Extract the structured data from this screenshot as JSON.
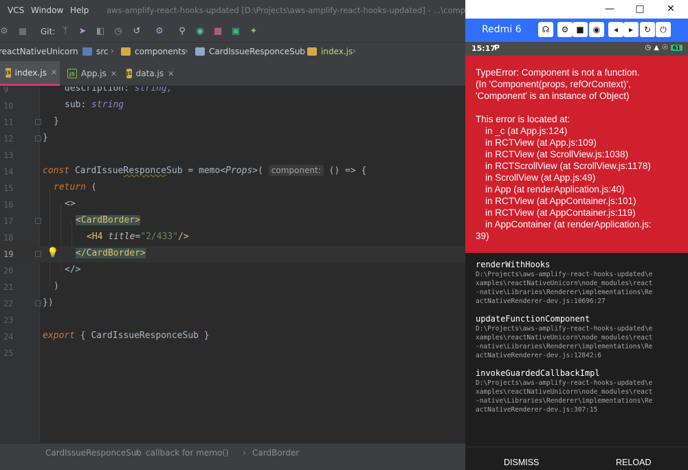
{
  "ide": {
    "menu": [
      "VCS",
      "Window",
      "Help"
    ],
    "window_title": "aws-amplify-react-hooks-updated [D:\\Projects\\aws-amplify-react-hooks-updated] - ...\\components",
    "git_label": "Git:",
    "breadcrumbs": [
      "reactNativeUnicorn",
      "src",
      "components",
      "CardIssueResponceSub",
      "index.js"
    ],
    "tabs": [
      {
        "label": "index.js",
        "icon": "js-file-icon",
        "active": true
      },
      {
        "label": "App.js",
        "icon": "node-file-icon",
        "active": false
      },
      {
        "label": "data.js",
        "icon": "js-file-icon",
        "active": false
      }
    ],
    "code_lines": [
      {
        "num": "9",
        "text": "description: string,"
      },
      {
        "num": "10",
        "text": "sub: string"
      },
      {
        "num": "11",
        "text": "}"
      },
      {
        "num": "12",
        "text": "}"
      },
      {
        "num": "13",
        "text": ""
      },
      {
        "num": "14",
        "text": "const CardIssueResponceSub = memo<Props>( component: () => {"
      },
      {
        "num": "15",
        "text": "return ("
      },
      {
        "num": "16",
        "text": "<>"
      },
      {
        "num": "17",
        "text": "<CardBorder>"
      },
      {
        "num": "18",
        "text": "<H4 title=\"2/433\"/>"
      },
      {
        "num": "19",
        "text": "</CardBorder>"
      },
      {
        "num": "20",
        "text": "</>"
      },
      {
        "num": "21",
        "text": ")"
      },
      {
        "num": "22",
        "text": "})"
      },
      {
        "num": "23",
        "text": ""
      },
      {
        "num": "24",
        "text": "export { CardIssueResponceSub }"
      },
      {
        "num": "25",
        "text": ""
      }
    ],
    "code_tokens": {
      "l9_prop": "description:",
      "l9_type": "string,",
      "l10_prop": "sub:",
      "l10_type": "string",
      "l14_const": "const",
      "l14_name_a": "CardIssue",
      "l14_name_b": "Responce",
      "l14_name_c": "Sub",
      "l14_eq": "=",
      "l14_memo": "memo",
      "l14_lt": "<",
      "l14_props": "Props",
      "l14_gt": ">(",
      "l14_hint": "component:",
      "l14_arrow": "() => {",
      "l15_return": "return",
      "l15_paren": "(",
      "l16": "<>",
      "l17_lt": "<",
      "l17_tag": "CardBorder",
      "l17_gt": ">",
      "l18_lt": "<",
      "l18_tag": "H4",
      "l18_attr": "title",
      "l18_eq": "=",
      "l18_str": "\"2/433\"",
      "l18_end": "/>",
      "l19_lt": "</",
      "l19_tag": "CardBorder",
      "l19_gt": ">",
      "l20": "</>",
      "l21": ")",
      "l22": "})",
      "l11": "}",
      "l12": "}",
      "l24_export": "export",
      "l24_rest": "{ CardIssueResponceSub }"
    },
    "statusbar": [
      "CardIssueResponceSub",
      "callback for memo()",
      "CardBorder"
    ],
    "colors": {
      "tab_accent": "#d5366e",
      "keyword": "#cc7832",
      "function": "#ffc66d",
      "string": "#6a8759"
    }
  },
  "emulator": {
    "device_name": "Redmi 6",
    "window_controls": [
      "minimize-icon",
      "maximize-icon",
      "close-icon"
    ],
    "device_buttons": [
      "headphones-icon",
      "settings-icon",
      "video-icon",
      "camera-icon",
      "volume-down-icon",
      "volume-up-icon",
      "rotate-icon",
      "power-icon"
    ],
    "android_time": "15:17",
    "android_notif": "P",
    "battery": "61",
    "error_title": "TypeError: Component is not a function.\n(In 'Component(props, refOrContext)', 'Component' is an instance of Object)",
    "located_header": "This error is located at:",
    "frames": [
      "in _c (at App.js:124)",
      "in RCTView (at App.js:109)",
      "in RCTView (at ScrollView.js:1038)",
      "in RCTScrollView (at ScrollView.js:1178)",
      "in ScrollView (at App.js:49)",
      "in App (at renderApplication.js:40)",
      "in RCTView (at AppContainer.js:101)",
      "in RCTView (at AppContainer.js:119)",
      "in AppContainer (at renderApplication.js:"
    ],
    "frames_tail": "39)",
    "stack": [
      {
        "name": "renderWithHooks",
        "path": "D:\\Projects\\aws-amplify-react-hooks-updated\\examples\\reactNativeUnicorn\\node_modules\\react-native\\Libraries\\Renderer\\implementations\\ReactNativeRenderer-dev.js:10696:27"
      },
      {
        "name": "updateFunctionComponent",
        "path": "D:\\Projects\\aws-amplify-react-hooks-updated\\examples\\reactNativeUnicorn\\node_modules\\react-native\\Libraries\\Renderer\\implementations\\ReactNativeRenderer-dev.js:12842:6"
      },
      {
        "name": "invokeGuardedCallbackImpl",
        "path": "D:\\Projects\\aws-amplify-react-hooks-updated\\examples\\reactNativeUnicorn\\node_modules\\react-native\\Libraries\\Renderer\\implementations\\ReactNativeRenderer-dev.js:307:15"
      }
    ],
    "buttons": {
      "dismiss": "DISMISS",
      "reload": "RELOAD"
    },
    "colors": {
      "device_bar": "#2f6ffb",
      "redbox": "#d0202e",
      "stack_bg": "#1e1e1e"
    }
  }
}
